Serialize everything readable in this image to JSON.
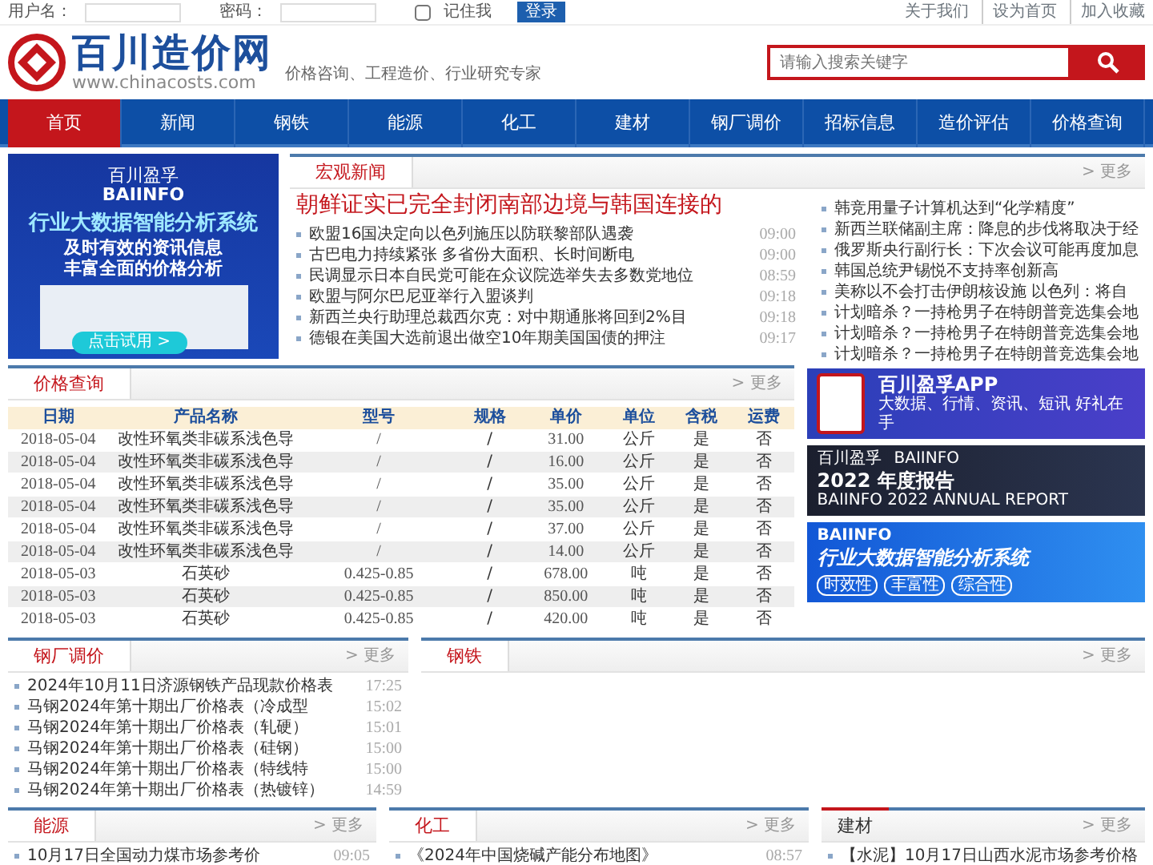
{
  "top_bar": {
    "username_label": "用户名：",
    "password_label": "密码：",
    "remember": {
      "label": "记住我",
      "checked": false
    },
    "login_button": "登录",
    "links": [
      "关于我们",
      "设为首页",
      "加入收藏"
    ]
  },
  "header": {
    "logo_name": "百川造价网",
    "logo_url": "www.chinacosts.com",
    "slogan": "价格咨询、工程造价、行业研究专家",
    "search": {
      "placeholder": "请输入搜索关键字"
    }
  },
  "nav": [
    {
      "label": "首页",
      "selected": true
    },
    {
      "label": "新闻",
      "selected": false
    },
    {
      "label": "钢铁",
      "selected": false
    },
    {
      "label": "能源",
      "selected": false
    },
    {
      "label": "化工",
      "selected": false
    },
    {
      "label": "建材",
      "selected": false
    },
    {
      "label": "钢厂调价",
      "selected": false
    },
    {
      "label": "招标信息",
      "selected": false
    },
    {
      "label": "造价评估",
      "selected": false
    },
    {
      "label": "价格查询",
      "selected": false
    }
  ],
  "banner": {
    "brand": "百川盈孚",
    "brand_en": "BAIINFO",
    "title": "行业大数据智能分析系统",
    "lines": [
      "及时有效的资讯信息",
      "丰富全面的价格分析"
    ],
    "button": "点击试用 >"
  },
  "macro_news": {
    "tab": "宏观新闻",
    "more": "> 更多",
    "headline": "朝鲜证实已完全封闭南部边境与韩国连接的",
    "items": [
      {
        "title": "欧盟16国决定向以色列施压以防联黎部队遇袭",
        "time": "09:00"
      },
      {
        "title": "古巴电力持续紧张 多省份大面积、长时间断电",
        "time": "09:00"
      },
      {
        "title": "民调显示日本自民党可能在众议院选举失去多数党地位",
        "time": "08:59"
      },
      {
        "title": "欧盟与阿尔巴尼亚举行入盟谈判",
        "time": "09:18"
      },
      {
        "title": "新西兰央行助理总裁西尔克：对中期通胀将回到2%目",
        "time": "09:18"
      },
      {
        "title": "德银在美国大选前退出做空10年期美国国债的押注",
        "time": "09:17"
      }
    ],
    "side_items": [
      "韩竞用量子计算机达到“化学精度”",
      "新西兰联储副主席：降息的步伐将取决于经",
      "俄罗斯央行副行长：下次会议可能再度加息",
      "韩国总统尹锡悦不支持率创新高",
      "美称以不会打击伊朗核设施 以色列：将自",
      "计划暗杀？一持枪男子在特朗普竞选集会地",
      "计划暗杀？一持枪男子在特朗普竞选集会地",
      "计划暗杀？一持枪男子在特朗普竞选集会地"
    ]
  },
  "price_query": {
    "tab": "价格查询",
    "more": "> 更多",
    "table": {
      "columns": [
        "日期",
        "产品名称",
        "型号",
        "规格",
        "单价",
        "单位",
        "含税",
        "运费"
      ],
      "rows": [
        [
          "2018-05-04",
          "改性环氧类非碳系浅色导",
          "/",
          "/",
          "31.00",
          "公斤",
          "是",
          "否"
        ],
        [
          "2018-05-04",
          "改性环氧类非碳系浅色导",
          "/",
          "/",
          "16.00",
          "公斤",
          "是",
          "否"
        ],
        [
          "2018-05-04",
          "改性环氧类非碳系浅色导",
          "/",
          "/",
          "35.00",
          "公斤",
          "是",
          "否"
        ],
        [
          "2018-05-04",
          "改性环氧类非碳系浅色导",
          "/",
          "/",
          "35.00",
          "公斤",
          "是",
          "否"
        ],
        [
          "2018-05-04",
          "改性环氧类非碳系浅色导",
          "/",
          "/",
          "37.00",
          "公斤",
          "是",
          "否"
        ],
        [
          "2018-05-04",
          "改性环氧类非碳系浅色导",
          "/",
          "/",
          "14.00",
          "公斤",
          "是",
          "否"
        ],
        [
          "2018-05-03",
          "石英砂",
          "0.425-0.85",
          "/",
          "678.00",
          "吨",
          "是",
          "否"
        ],
        [
          "2018-05-03",
          "石英砂",
          "0.425-0.85",
          "/",
          "850.00",
          "吨",
          "是",
          "否"
        ],
        [
          "2018-05-03",
          "石英砂",
          "0.425-0.85",
          "/",
          "420.00",
          "吨",
          "是",
          "否"
        ]
      ]
    }
  },
  "ads": [
    {
      "kind": "app",
      "title": "百川盈孚APP",
      "subtitle": "大数据、行情、资讯、短讯 好礼在手"
    },
    {
      "kind": "report",
      "brand": "百川盈孚",
      "brand_en": "BAIINFO",
      "title": "2022 年度报告",
      "subtitle": "BAIINFO 2022 ANNUAL REPORT"
    },
    {
      "kind": "system",
      "brand_en": "BAIINFO",
      "title": "行业大数据智能分析系统",
      "tags": [
        "时效性",
        "丰富性",
        "综合性"
      ]
    }
  ],
  "section_rows": [
    [
      {
        "kind": "tab",
        "tab": "钢厂调价",
        "more": "> 更多",
        "items": [
          {
            "title": "2024年10月11日济源钢铁产品现款价格表",
            "time": "17:25"
          },
          {
            "title": "马钢2024年第十期出厂价格表（冷成型",
            "time": "15:02"
          },
          {
            "title": "马钢2024年第十期出厂价格表（轧硬）",
            "time": "15:01"
          },
          {
            "title": "马钢2024年第十期出厂价格表（硅钢）",
            "time": "15:00"
          },
          {
            "title": "马钢2024年第十期出厂价格表（特线特",
            "time": "15:00"
          },
          {
            "title": "马钢2024年第十期出厂价格表（热镀锌）",
            "time": "14:59"
          }
        ]
      },
      {
        "kind": "tab",
        "tab": "钢铁",
        "more": "> 更多"
      }
    ],
    [
      {
        "kind": "tab",
        "tab": "能源",
        "more": "> 更多",
        "items": [
          {
            "title": "10月17日全国动力煤市场参考价",
            "time": "09:05"
          }
        ]
      },
      {
        "kind": "tab",
        "tab": "化工",
        "more": "> 更多",
        "items": [
          {
            "title": "《2024年中国烧碱产能分布地图》",
            "time": "08:57"
          }
        ]
      },
      {
        "kind": "plain",
        "tab": "建材",
        "more": "> 更多",
        "items": [
          {
            "title": "【水泥】10月17日山西水泥市场参考价格"
          }
        ]
      }
    ]
  ]
}
